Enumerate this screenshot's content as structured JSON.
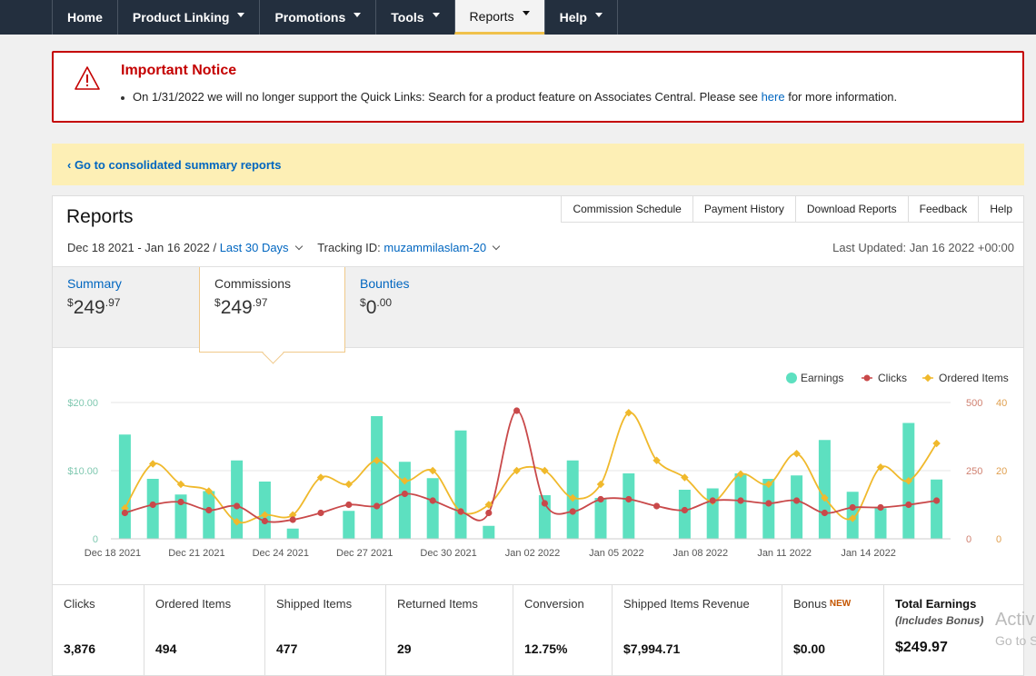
{
  "nav": {
    "items": [
      {
        "label": "Home",
        "caret": false,
        "active": false
      },
      {
        "label": "Product Linking",
        "caret": true,
        "active": false
      },
      {
        "label": "Promotions",
        "caret": true,
        "active": false
      },
      {
        "label": "Tools",
        "caret": true,
        "active": false
      },
      {
        "label": "Reports",
        "caret": true,
        "active": true
      },
      {
        "label": "Help",
        "caret": true,
        "active": false
      }
    ]
  },
  "notice": {
    "title": "Important Notice",
    "text_before": "On 1/31/2022 we will no longer support the Quick Links: Search for a product feature on Associates Central. Please see ",
    "link": "here",
    "text_after": " for more information."
  },
  "banner": {
    "link": "‹ Go to consolidated summary reports"
  },
  "reports": {
    "title": "Reports",
    "buttons": [
      "Commission Schedule",
      "Payment History",
      "Download Reports",
      "Feedback",
      "Help"
    ],
    "date_range": "Dec 18 2021 - Jan 16 2022 / ",
    "period": "Last 30 Days",
    "tracking_label": "Tracking ID: ",
    "tracking_id": "muzammilaslam-20",
    "last_updated": "Last Updated: Jan 16 2022 +00:00",
    "tabs": [
      {
        "label": "Summary",
        "currency": "$",
        "whole": "249",
        "cents": ".97"
      },
      {
        "label": "Commissions",
        "currency": "$",
        "whole": "249",
        "cents": ".97"
      },
      {
        "label": "Bounties",
        "currency": "$",
        "whole": "0",
        "cents": ".00"
      }
    ]
  },
  "chart_data": {
    "type": "bar",
    "legend": [
      "Earnings",
      "Clicks",
      "Ordered Items"
    ],
    "legend_position": "top-right",
    "colors": {
      "earnings": "#5de0c0",
      "clicks": "#c9494a",
      "ordered": "#f0b92c"
    },
    "x_tick_labels": [
      "Dec 18 2021",
      "Dec 21 2021",
      "Dec 24 2021",
      "Dec 27 2021",
      "Dec 30 2021",
      "Jan 02 2022",
      "Jan 05 2022",
      "Jan 08 2022",
      "Jan 11 2022",
      "Jan 14 2022"
    ],
    "y_left_ticks": [
      "$20.00",
      "$10.00",
      "0"
    ],
    "y_clicks_ticks": [
      "500",
      "250",
      "0"
    ],
    "y_ordered_ticks": [
      "40",
      "20",
      "0"
    ],
    "y_left_max": 20,
    "y_clicks_max": 500,
    "y_ordered_max": 40,
    "earnings": [
      15.3,
      8.8,
      6.5,
      7.0,
      11.5,
      8.4,
      1.5,
      0,
      4.1,
      18.0,
      11.3,
      8.9,
      15.9,
      1.9,
      0,
      6.4,
      11.5,
      6.0,
      9.6,
      0,
      7.2,
      7.4,
      9.6,
      8.8,
      9.3,
      14.5,
      6.9,
      4.5,
      17.0,
      8.7
    ],
    "clicks": [
      95,
      125,
      135,
      105,
      120,
      65,
      70,
      95,
      125,
      120,
      165,
      140,
      100,
      95,
      470,
      130,
      100,
      145,
      145,
      120,
      105,
      140,
      140,
      130,
      140,
      95,
      115,
      115,
      125,
      140
    ],
    "ordered_items": [
      9,
      22,
      16,
      14,
      5,
      7,
      7,
      18,
      16,
      23,
      17,
      20,
      8,
      10,
      20,
      20,
      12,
      16,
      37,
      23,
      18,
      11,
      19,
      16,
      25,
      12,
      6,
      21,
      17,
      28
    ]
  },
  "stats": [
    {
      "label": "Clicks",
      "value": "3,876"
    },
    {
      "label": "Ordered Items",
      "value": "494"
    },
    {
      "label": "Shipped Items",
      "value": "477"
    },
    {
      "label": "Returned Items",
      "value": "29"
    },
    {
      "label": "Conversion",
      "value": "12.75%"
    },
    {
      "label": "Shipped Items Revenue",
      "value": "$7,994.71"
    },
    {
      "label": "Bonus",
      "badge": "NEW",
      "value": "$0.00"
    },
    {
      "label": "Total Earnings",
      "sub": "(Includes Bonus)",
      "value": "$249.97"
    }
  ],
  "watermark": {
    "line1": "Activ",
    "line2": "Go to S"
  }
}
